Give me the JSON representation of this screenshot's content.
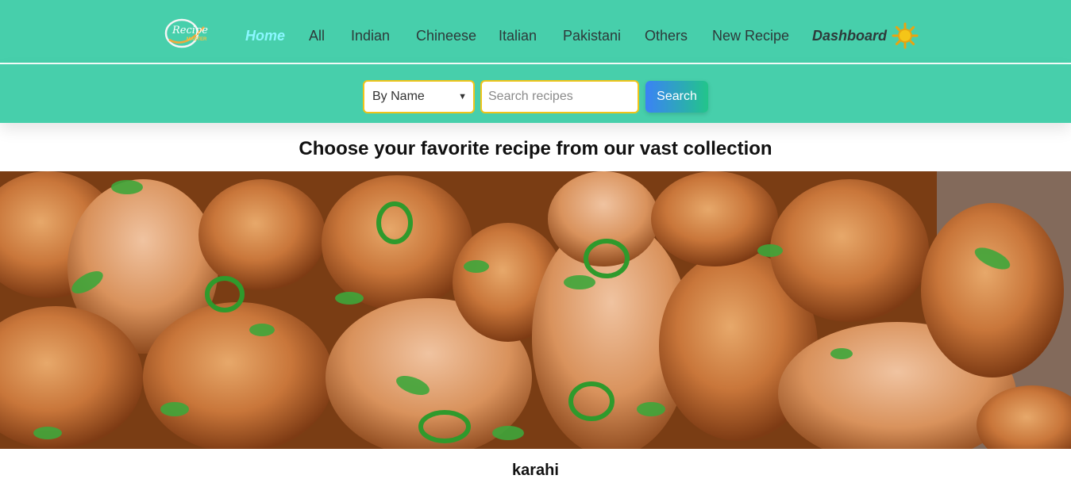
{
  "nav": {
    "logo_text": "Recipe MASTER",
    "links": [
      {
        "label": "Home",
        "active": true
      },
      {
        "label": "All"
      },
      {
        "label": "Indian"
      },
      {
        "label": "Chineese"
      },
      {
        "label": "Italian"
      },
      {
        "label": "Pakistani"
      },
      {
        "label": "Others"
      },
      {
        "label": "New Recipe"
      },
      {
        "label": "Dashboard"
      }
    ],
    "theme_icon": "sun-icon"
  },
  "search": {
    "filter_selected": "By Name",
    "placeholder": "Search recipes",
    "button_label": "Search"
  },
  "main": {
    "headline": "Choose your favorite recipe from our vast collection",
    "featured_recipe_name": "karahi"
  },
  "colors": {
    "nav_bg": "#47cfab",
    "active_link": "#8af7ff",
    "input_border": "#f0c419"
  }
}
